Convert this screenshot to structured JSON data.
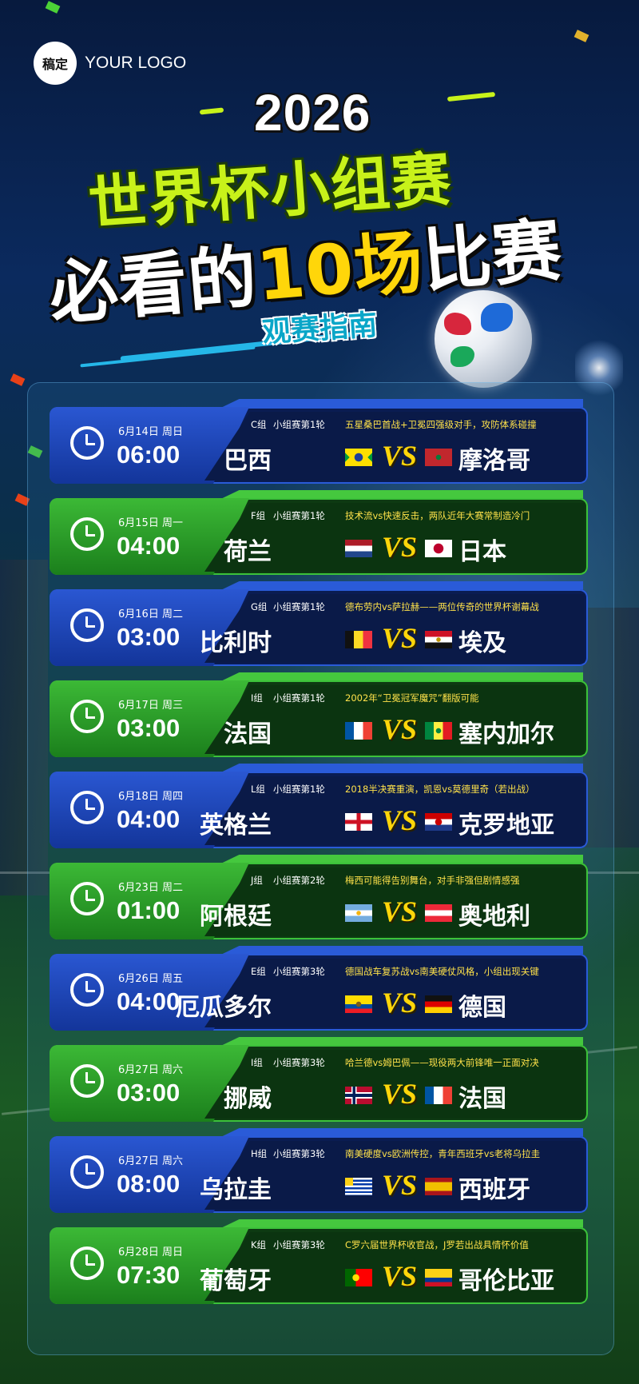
{
  "logo": {
    "mark": "稿定",
    "text": "YOUR LOGO"
  },
  "header": {
    "year": "2026",
    "title_line1": "世界杯小组赛",
    "title_line2_pre": "必看的",
    "title_line2_num": "10场",
    "title_line2_post": "比赛",
    "subtitle": "观赛指南"
  },
  "colors": {
    "blue_card": "#13359a",
    "green_card": "#1b7f1c",
    "accent_yellow": "#ffd60a",
    "title_green": "#c8f21a"
  },
  "matches": [
    {
      "date": "6月14日  周日",
      "time": "06:00",
      "group": "C组",
      "round": "小组赛第1轮",
      "note": "五星桑巴首战+卫冕四强级对手，攻防体系碰撞",
      "team_a": "巴西",
      "team_b": "摩洛哥",
      "vs": "VS",
      "flag_a": "brazil-flag-icon",
      "flag_b": "morocco-flag-icon"
    },
    {
      "date": "6月15日  周一",
      "time": "04:00",
      "group": "F组",
      "round": "小组赛第1轮",
      "note": "技术流vs快速反击，两队近年大赛常制造冷门",
      "team_a": "荷兰",
      "team_b": "日本",
      "vs": "VS",
      "flag_a": "netherlands-flag-icon",
      "flag_b": "japan-flag-icon"
    },
    {
      "date": "6月16日  周二",
      "time": "03:00",
      "group": "G组",
      "round": "小组赛第1轮",
      "note": "德布劳内vs萨拉赫——两位传奇的世界杯谢幕战",
      "team_a": "比利时",
      "team_b": "埃及",
      "vs": "VS",
      "flag_a": "belgium-flag-icon",
      "flag_b": "egypt-flag-icon"
    },
    {
      "date": "6月17日  周三",
      "time": "03:00",
      "group": "I组",
      "round": "小组赛第1轮",
      "note": "2002年“卫冕冠军魔咒”翻版可能",
      "team_a": "法国",
      "team_b": "塞内加尔",
      "vs": "VS",
      "flag_a": "france-flag-icon",
      "flag_b": "senegal-flag-icon"
    },
    {
      "date": "6月18日  周四",
      "time": "04:00",
      "group": "L组",
      "round": "小组赛第1轮",
      "note": "2018半决赛重演，凯恩vs莫德里奇（若出战）",
      "team_a": "英格兰",
      "team_b": "克罗地亚",
      "vs": "VS",
      "flag_a": "england-flag-icon",
      "flag_b": "croatia-flag-icon"
    },
    {
      "date": "6月23日  周二",
      "time": "01:00",
      "group": "J组",
      "round": "小组赛第2轮",
      "note": "梅西可能得告别舞台，对手非强但剧情感强",
      "team_a": "阿根廷",
      "team_b": "奥地利",
      "vs": "VS",
      "flag_a": "argentina-flag-icon",
      "flag_b": "austria-flag-icon"
    },
    {
      "date": "6月26日  周五",
      "time": "04:00",
      "group": "E组",
      "round": "小组赛第3轮",
      "note": "德国战车复苏战vs南美硬仗风格，小组出现关键",
      "team_a": "厄瓜多尔",
      "team_b": "德国",
      "vs": "VS",
      "flag_a": "ecuador-flag-icon",
      "flag_b": "germany-flag-icon"
    },
    {
      "date": "6月27日  周六",
      "time": "03:00",
      "group": "I组",
      "round": "小组赛第3轮",
      "note": "哈兰德vs姆巴佩——现役两大前锋唯一正面对决",
      "team_a": "挪威",
      "team_b": "法国",
      "vs": "VS",
      "flag_a": "norway-flag-icon",
      "flag_b": "france-flag-icon"
    },
    {
      "date": "6月27日  周六",
      "time": "08:00",
      "group": "H组",
      "round": "小组赛第3轮",
      "note": "南美硬度vs欧洲传控，青年西班牙vs老将乌拉圭",
      "team_a": "乌拉圭",
      "team_b": "西班牙",
      "vs": "VS",
      "flag_a": "uruguay-flag-icon",
      "flag_b": "spain-flag-icon"
    },
    {
      "date": "6月28日  周日",
      "time": "07:30",
      "group": "K组",
      "round": "小组赛第3轮",
      "note": "C罗六届世界杯收官战，J罗若出战具情怀价值",
      "team_a": "葡萄牙",
      "team_b": "哥伦比亚",
      "vs": "VS",
      "flag_a": "portugal-flag-icon",
      "flag_b": "colombia-flag-icon"
    }
  ]
}
